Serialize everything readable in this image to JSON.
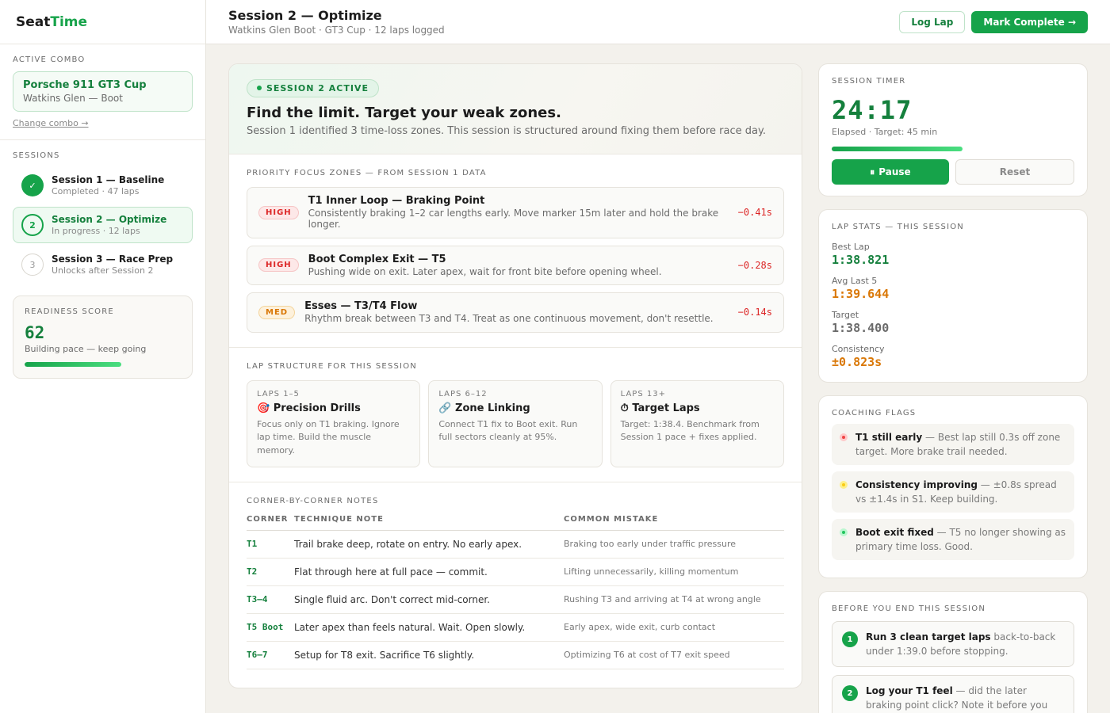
{
  "app": {
    "logo_a": "Seat",
    "logo_b": "Time"
  },
  "sidebar": {
    "combo_label": "ACTIVE COMBO",
    "combo_car": "Porsche 911 GT3 Cup",
    "combo_track": "Watkins Glen — Boot",
    "change_link": "Change combo →",
    "sessions_label": "SESSIONS",
    "sessions": [
      {
        "num": "✓",
        "title": "Session 1 — Baseline",
        "sub": "Completed · 47 laps"
      },
      {
        "num": "2",
        "title": "Session 2 — Optimize",
        "sub": "In progress · 12 laps"
      },
      {
        "num": "3",
        "title": "Session 3 — Race Prep",
        "sub": "Unlocks after Session 2"
      }
    ],
    "readiness_label": "READINESS SCORE",
    "readiness_score": "62",
    "readiness_note": "Building pace — keep going",
    "readiness_fraction": 0.62
  },
  "header": {
    "title": "Session 2 — Optimize",
    "subtitle": "Watkins Glen Boot · GT3 Cup · 12 laps logged",
    "log_lap": "Log Lap",
    "mark_complete": "Mark Complete →"
  },
  "hero": {
    "pill": "SESSION 2 ACTIVE",
    "title": "Find the limit. Target your weak zones.",
    "subtitle": "Session 1 identified 3 time-loss zones. This session is structured around fixing them before race day."
  },
  "zones": {
    "label": "PRIORITY FOCUS ZONES — FROM SESSION 1 DATA",
    "items": [
      {
        "tag": "HIGH",
        "title": "T1 Inner Loop — Braking Point",
        "desc": "Consistently braking 1–2 car lengths early. Move marker 15m later and hold the brake longer.",
        "delta": "−0.41s"
      },
      {
        "tag": "HIGH",
        "title": "Boot Complex Exit — T5",
        "desc": "Pushing wide on exit. Later apex, wait for front bite before opening wheel.",
        "delta": "−0.28s"
      },
      {
        "tag": "MED",
        "title": "Esses — T3/T4 Flow",
        "desc": "Rhythm break between T3 and T4. Treat as one continuous movement, don't resettle.",
        "delta": "−0.14s"
      }
    ]
  },
  "structure": {
    "label": "LAP STRUCTURE FOR THIS SESSION",
    "items": [
      {
        "laps": "LAPS 1–5",
        "icon": "🎯",
        "title": "Precision Drills",
        "desc": "Focus only on T1 braking. Ignore lap time. Build the muscle memory."
      },
      {
        "laps": "LAPS 6–12",
        "icon": "🔗",
        "title": "Zone Linking",
        "desc": "Connect T1 fix to Boot exit. Run full sectors cleanly at 95%."
      },
      {
        "laps": "LAPS 13+",
        "icon": "⏱",
        "title": "Target Laps",
        "desc": "Target: 1:38.4. Benchmark from Session 1 pace + fixes applied."
      }
    ]
  },
  "corners": {
    "label": "CORNER-BY-CORNER NOTES",
    "headers": [
      "CORNER",
      "TECHNIQUE NOTE",
      "COMMON MISTAKE"
    ],
    "rows": [
      [
        "T1",
        "Trail brake deep, rotate on entry. No early apex.",
        "Braking too early under traffic pressure"
      ],
      [
        "T2",
        "Flat through here at full pace — commit.",
        "Lifting unnecessarily, killing momentum"
      ],
      [
        "T3–4",
        "Single fluid arc. Don't correct mid-corner.",
        "Rushing T3 and arriving at T4 at wrong angle"
      ],
      [
        "T5 Boot",
        "Later apex than feels natural. Wait. Open slowly.",
        "Early apex, wide exit, curb contact"
      ],
      [
        "T6–7",
        "Setup for T8 exit. Sacrifice T6 slightly.",
        "Optimizing T6 at cost of T7 exit speed"
      ]
    ]
  },
  "timer": {
    "label": "SESSION TIMER",
    "value": "24:17",
    "sub": "Elapsed · Target: 45 min",
    "pause": "Pause",
    "reset": "Reset"
  },
  "stats": {
    "label": "LAP STATS — THIS SESSION",
    "items": [
      {
        "label": "Best Lap",
        "value": "1:38.821",
        "color": "#15803d"
      },
      {
        "label": "Avg Last 5",
        "value": "1:39.644",
        "color": "#d97706"
      },
      {
        "label": "Target",
        "value": "1:38.400",
        "color": "#6b6b6b"
      },
      {
        "label": "Consistency",
        "value": "±0.823s",
        "color": "#d97706"
      }
    ]
  },
  "flags": {
    "label": "COACHING FLAGS",
    "items": [
      {
        "icon": "red-circle-icon",
        "color": "#dc2626",
        "title": "T1 still early",
        "text": " — Best lap still 0.3s off zone target. More brake trail needed."
      },
      {
        "icon": "yellow-circle-icon",
        "color": "#eab308",
        "title": "Consistency improving",
        "text": " — ±0.8s spread vs ±1.4s in S1. Keep building."
      },
      {
        "icon": "green-circle-icon",
        "color": "#22c55e",
        "title": "Boot exit fixed",
        "text": " — T5 no longer showing as primary time loss. Good."
      }
    ]
  },
  "todo": {
    "label": "BEFORE YOU END THIS SESSION",
    "items": [
      {
        "num": "1",
        "title": "Run 3 clean target laps",
        "text": " back-to-back under 1:39.0 before stopping."
      },
      {
        "num": "2",
        "title": "Log your T1 feel",
        "text": " — did the later braking point click? Note it before you"
      }
    ]
  }
}
